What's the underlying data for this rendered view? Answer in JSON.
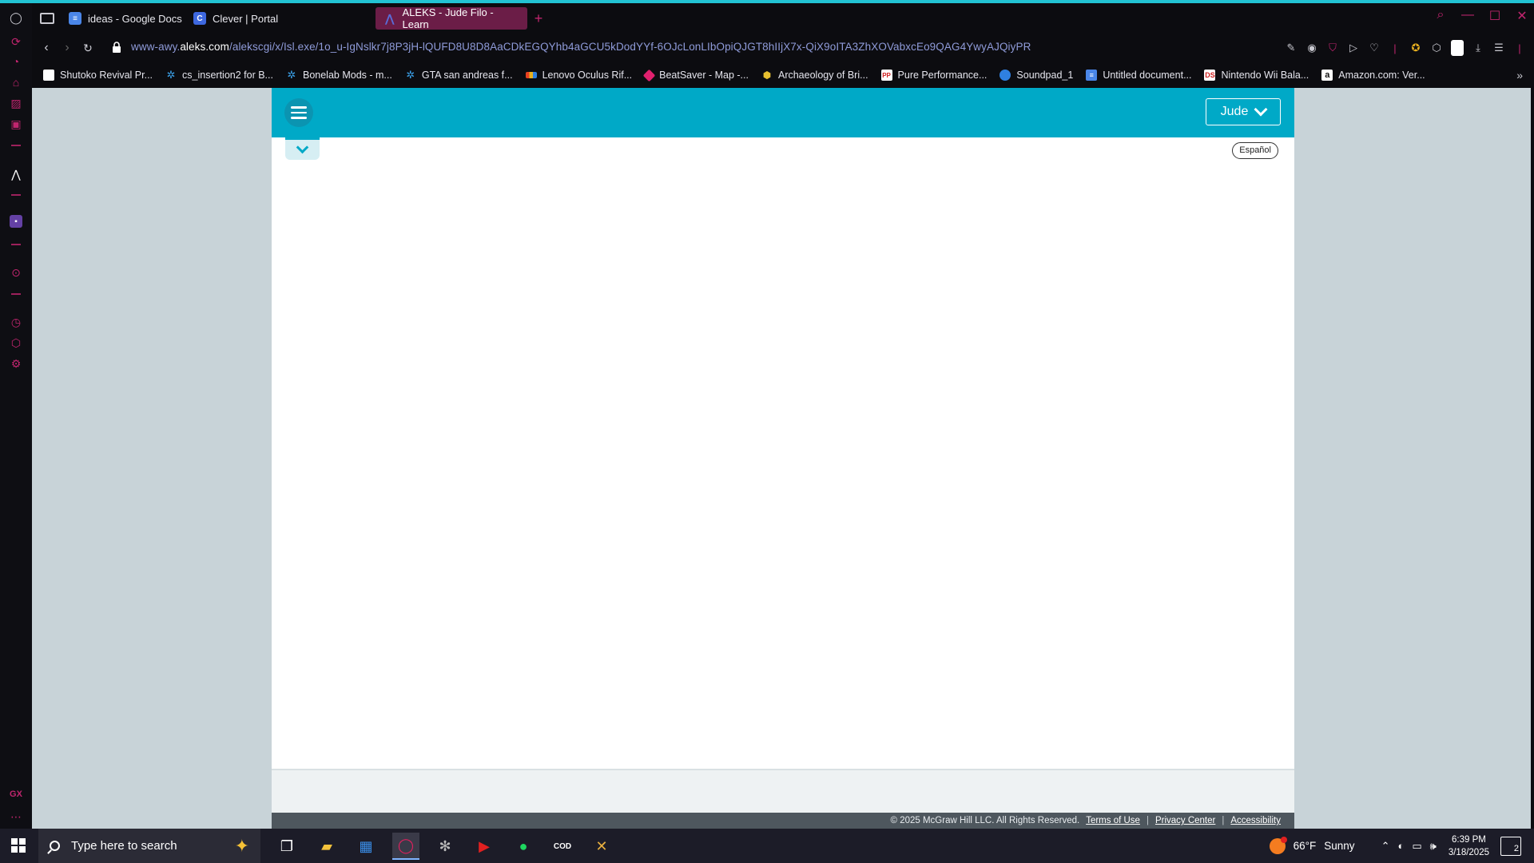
{
  "browser": {
    "tabs": [
      {
        "label": "ideas - Google Docs",
        "favicon": "docs-icon"
      },
      {
        "label": "Clever | Portal",
        "favicon": "clever-icon"
      },
      {
        "label": "ALEKS - Jude Filo - Learn",
        "favicon": "aleks-icon",
        "active": true
      }
    ],
    "url": {
      "prefix": "www-awy.",
      "domain": "aleks.com",
      "path": "/alekscgi/x/Isl.exe/1o_u-IgNslkr7j8P3jH-lQUFD8U8D8AaCDkEGQYhb4aGCU5kDodYYf-6OJcLonLIbOpiQJGT8hIIjX7x-QiX9oITA3ZhXOVabxcEo9QAG4YwyAJQiyPR"
    },
    "bookmarks": [
      {
        "label": "Shutoko Revival Pr...",
        "icon": "page-icon",
        "color": "#ffffff"
      },
      {
        "label": "cs_insertion2 for B...",
        "icon": "gear-icon",
        "color": "#3aa0e8"
      },
      {
        "label": "Bonelab Mods - m...",
        "icon": "gear-icon",
        "color": "#3aa0e8"
      },
      {
        "label": "GTA san andreas f...",
        "icon": "gear-icon",
        "color": "#3aa0e8"
      },
      {
        "label": "Lenovo Oculus Rif...",
        "icon": "lenovo-icon",
        "color": "#e8b020"
      },
      {
        "label": "BeatSaver - Map -...",
        "icon": "beatsaver-icon",
        "color": "#e0206e"
      },
      {
        "label": "Archaeology of Bri...",
        "icon": "hexagon-icon",
        "color": "#e8c030"
      },
      {
        "label": "Pure Performance...",
        "icon": "pure-icon",
        "color": "#d02020"
      },
      {
        "label": "Soundpad_1",
        "icon": "soundpad-icon",
        "color": "#2f80e0"
      },
      {
        "label": "Untitled document...",
        "icon": "docs-icon",
        "color": "#4a86e8"
      },
      {
        "label": "Nintendo Wii Bala...",
        "icon": "ds-icon",
        "color": "#d02020"
      },
      {
        "label": "Amazon.com: Ver...",
        "icon": "amazon-icon",
        "color": "#ffffff"
      }
    ]
  },
  "aleks": {
    "user_label": "Jude",
    "lang_label": "Español",
    "footer": {
      "copyright": "© 2025 McGraw Hill LLC. All Rights Reserved.",
      "terms": "Terms of Use",
      "privacy": "Privacy Center",
      "accessibility": "Accessibility",
      "sep": "|"
    }
  },
  "taskbar": {
    "search_placeholder": "Type here to search",
    "weather_temp": "66°F",
    "weather_desc": "Sunny",
    "time": "6:39 PM",
    "date": "3/18/2025",
    "notif_count": "2"
  },
  "colors": {
    "accent": "#00a9c7",
    "opera_pink": "#c0256e",
    "active_tab": "#6b1d47"
  }
}
